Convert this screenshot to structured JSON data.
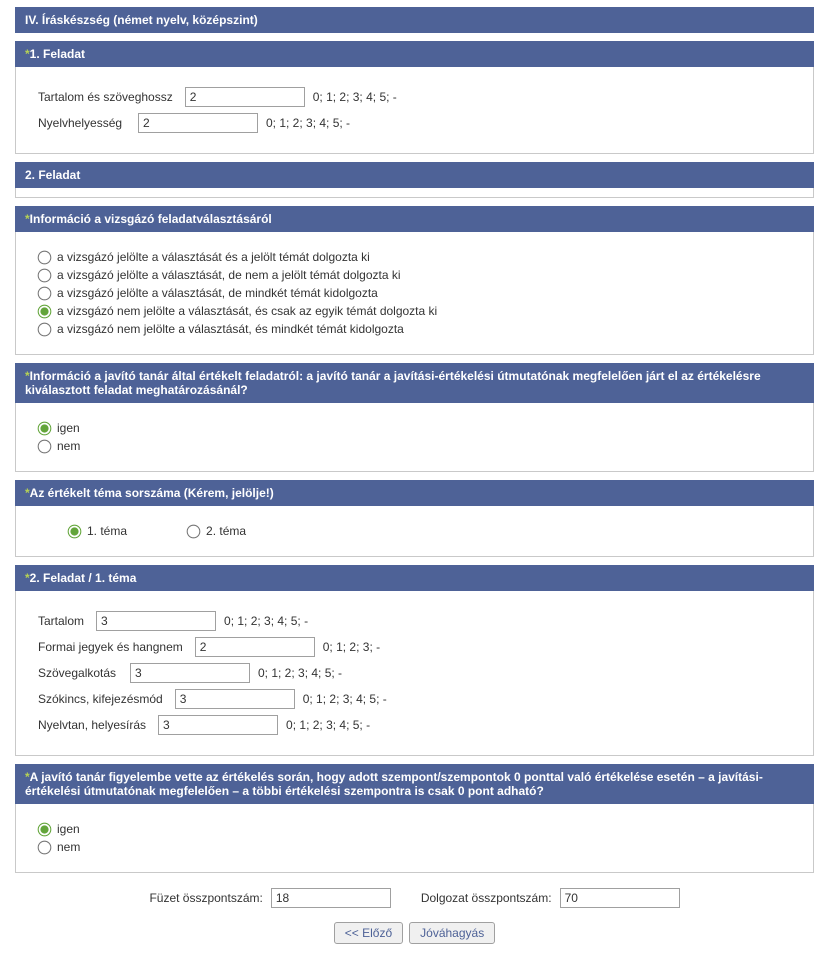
{
  "title": "IV. Íráskészség (német nyelv, középszint)",
  "asterisk": "*",
  "task1": {
    "header": "1. Feladat",
    "r1_label": "Tartalom és szöveghossz",
    "r1_value": "2",
    "r1_hint": "0; 1; 2; 3; 4; 5; -",
    "r2_label": "Nyelvhelyesség",
    "r2_value": "2",
    "r2_hint": "0; 1; 2; 3; 4; 5; -"
  },
  "task2_header": "2. Feladat",
  "info_choice": {
    "header": "Információ a vizsgázó feladatválasztásáról",
    "opts": [
      "a vizsgázó jelölte a választását és a jelölt témát dolgozta ki",
      "a vizsgázó jelölte a választását, de nem a jelölt témát dolgozta ki",
      "a vizsgázó jelölte a választását, de mindkét témát kidolgozta",
      "a vizsgázó nem jelölte a választását, és csak az egyik témát dolgozta ki",
      "a vizsgázó nem jelölte a választását, és mindkét témát kidolgozta"
    ]
  },
  "info_grader": {
    "header": "Információ a javító tanár által értékelt feladatról: a javító tanár a javítási-értékelési útmutatónak megfelelően járt el az értékelésre kiválasztott feladat meghatározásánál?",
    "yes": "igen",
    "no": "nem"
  },
  "theme_sel": {
    "header": "Az értékelt téma sorszáma (Kérem, jelölje!)",
    "t1": "1. téma",
    "t2": "2. téma"
  },
  "task2t1": {
    "header": "2. Feladat / 1. téma",
    "r1_label": "Tartalom",
    "r1_value": "3",
    "r1_hint": "0; 1; 2; 3; 4; 5; -",
    "r2_label": "Formai jegyek és hangnem",
    "r2_value": "2",
    "r2_hint": "0; 1; 2; 3; -",
    "r3_label": "Szövegalkotás",
    "r3_value": "3",
    "r3_hint": "0; 1; 2; 3; 4; 5; -",
    "r4_label": "Szókincs, kifejezésmód",
    "r4_value": "3",
    "r4_hint": "0; 1; 2; 3; 4; 5; -",
    "r5_label": "Nyelvtan, helyesírás",
    "r5_value": "3",
    "r5_hint": "0; 1; 2; 3; 4; 5; -"
  },
  "zero_rule": {
    "header": "A javító tanár figyelembe vette az értékelés során, hogy adott szempont/szempontok 0 ponttal való értékelése esetén – a javítási-értékelési útmutatónak megfelelően – a többi értékelési szempontra is csak 0 pont adható?",
    "yes": "igen",
    "no": "nem"
  },
  "footer": {
    "fuzet_label": "Füzet összpontszám:",
    "fuzet_value": "18",
    "dolgozat_label": "Dolgozat összpontszám:",
    "dolgozat_value": "70",
    "prev": "<< Előző",
    "approve": "Jóváhagyás"
  }
}
